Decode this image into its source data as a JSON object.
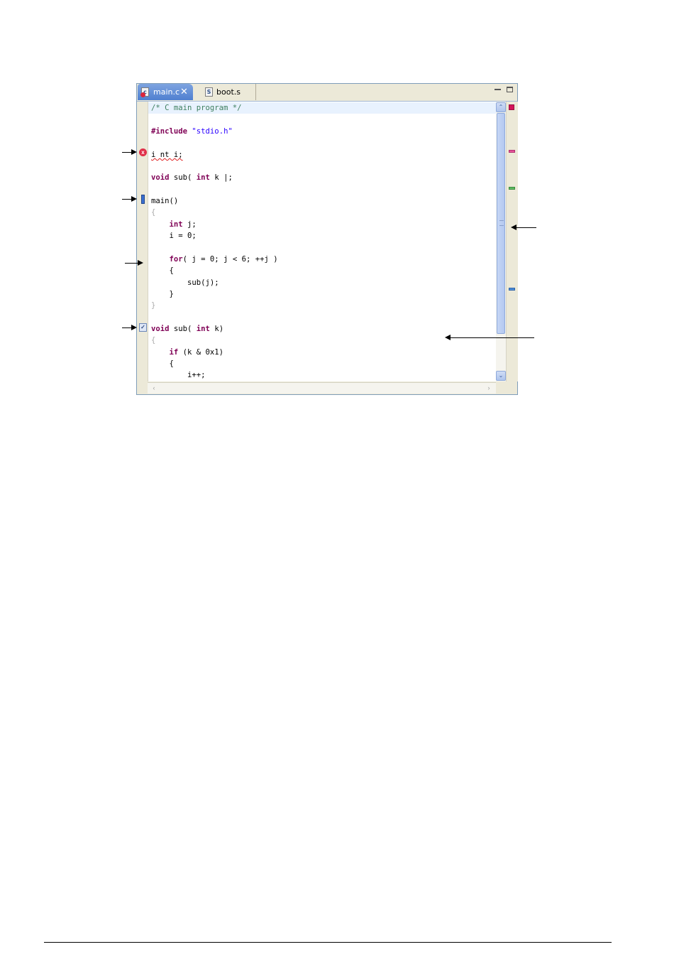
{
  "tabs": [
    {
      "label": "main.c",
      "close": "✕",
      "icon": "c-source-file-icon-with-error"
    },
    {
      "label": "boot.s",
      "icon": "assembly-source-file-icon",
      "icon_glyph": "S"
    }
  ],
  "code_lines": [
    {
      "id": "l1",
      "text": "/* C main program */"
    },
    {
      "id": "l3a",
      "text": "#include"
    },
    {
      "id": "l3b",
      "text": "\"stdio.h\""
    },
    {
      "id": "l5",
      "text": "i nt i;"
    },
    {
      "id": "l7a",
      "text": "void"
    },
    {
      "id": "l7b",
      "text": " sub( "
    },
    {
      "id": "l7c",
      "text": "int"
    },
    {
      "id": "l7d",
      "text": " k |;"
    },
    {
      "id": "l9",
      "text": "main()"
    },
    {
      "id": "l10",
      "text": "{"
    },
    {
      "id": "l11a",
      "text": "    int"
    },
    {
      "id": "l11b",
      "text": " j;"
    },
    {
      "id": "l12",
      "text": "    i = 0;"
    },
    {
      "id": "l14a",
      "text": "    for"
    },
    {
      "id": "l14b",
      "text": "( j = 0; j < 6; ++j )"
    },
    {
      "id": "l15",
      "text": "    {"
    },
    {
      "id": "l16",
      "text": "        sub(j);"
    },
    {
      "id": "l17",
      "text": "    }"
    },
    {
      "id": "l18",
      "text": "}"
    },
    {
      "id": "l20a",
      "text": "void"
    },
    {
      "id": "l20b",
      "text": " sub( "
    },
    {
      "id": "l20c",
      "text": "int"
    },
    {
      "id": "l20d",
      "text": " k)"
    },
    {
      "id": "l21",
      "text": "{"
    },
    {
      "id": "l22a",
      "text": "    if"
    },
    {
      "id": "l22b",
      "text": " (k & 0x1)"
    },
    {
      "id": "l23",
      "text": "    {"
    },
    {
      "id": "l24",
      "text": "        i++;"
    }
  ],
  "markers": {
    "error_glyph": "x",
    "task_glyph": "✓",
    "error": "error-marker-icon",
    "bookmark": "bookmark-marker-icon",
    "task": "task-marker-icon"
  },
  "scrollbar": {
    "up": "⌃",
    "down": "⌄",
    "left": "‹",
    "right": "›"
  },
  "colors": {
    "keyword": "#7f0055",
    "comment": "#3f7f5f",
    "string": "#2a00ff",
    "current_line": "#e8f2fe",
    "overview_error": "#d4145a",
    "overview_warning": "#e8549a",
    "overview_task": "#5dbb63",
    "overview_bookmark": "#4f8fd8"
  }
}
